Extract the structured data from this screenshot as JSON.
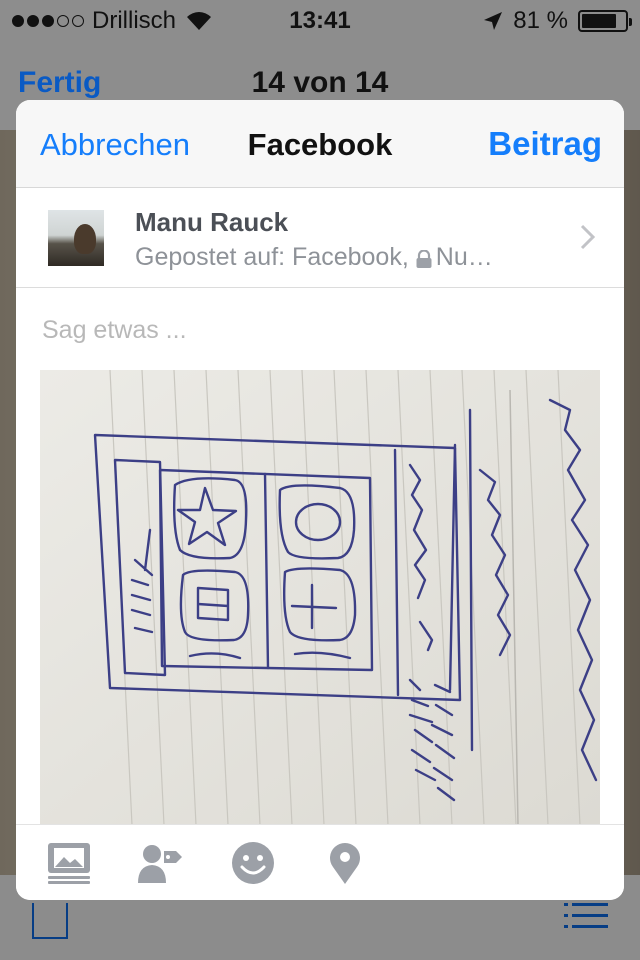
{
  "status_bar": {
    "carrier": "Drillisch",
    "time": "13:41",
    "battery_text": "81 %",
    "battery_level": 0.81,
    "signal_bars": 3
  },
  "background_nav": {
    "done_label": "Fertig",
    "count_label": "14 von 14"
  },
  "sheet": {
    "cancel_label": "Abbrechen",
    "title": "Facebook",
    "post_label": "Beitrag",
    "account": {
      "name": "Manu Rauck",
      "posted_to": "Gepostet auf: Facebook,",
      "audience": "Nu…"
    },
    "compose_placeholder": "Sag etwas ...",
    "toolbar": {
      "icons": [
        "album-icon",
        "tag-friends-icon",
        "feeling-icon",
        "location-icon"
      ]
    }
  },
  "colors": {
    "accent": "#157efb",
    "bg_accent": "#0a5ac4",
    "icon_gray": "#9ca0a7"
  }
}
